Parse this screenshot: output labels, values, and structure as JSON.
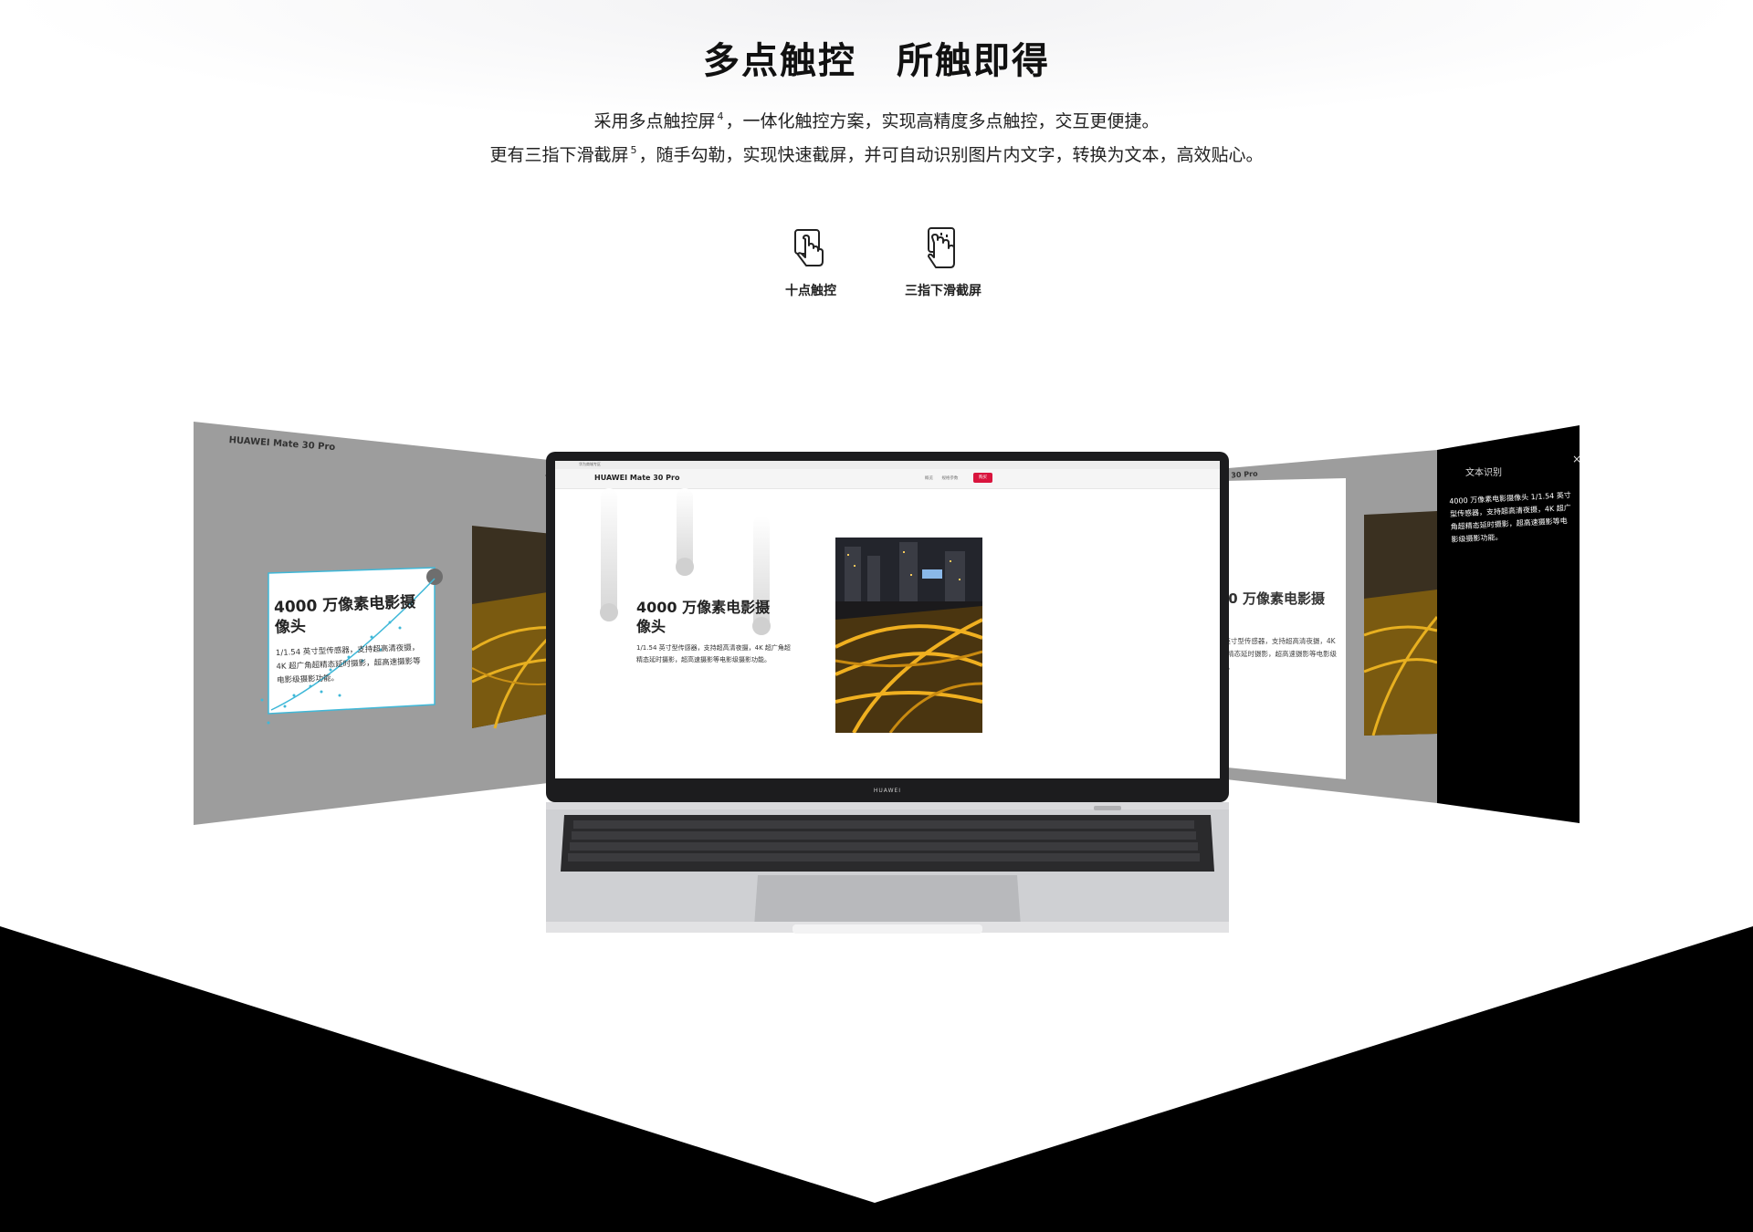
{
  "headline": {
    "part1": "多点触控",
    "part2": "所触即得"
  },
  "description": {
    "line1_a": "采用多点触控屏",
    "line1_sup": "4",
    "line1_b": "，一体化触控方案，实现高精度多点触控，交互更便捷。",
    "line2_a": "更有三指下滑截屏",
    "line2_sup": "5",
    "line2_b": "，随手勾勒，实现快速截屏，并可自动识别图片内文字，转换为文本，高效贴心。"
  },
  "features": [
    {
      "label": "十点触控",
      "icon": "single-finger-touch-icon"
    },
    {
      "label": "三指下滑截屏",
      "icon": "three-finger-swipe-icon"
    }
  ],
  "product_page": {
    "brand": "HUAWEI Mate 30 Pro",
    "top_bar_text": "华为商城专区",
    "nav_links": [
      "概览",
      "规格参数"
    ],
    "buy_label": "购买",
    "heading": "4000 万像素电影摄像头",
    "body": "1/1.54 英寸型传感器，支持超高清夜摄，4K 超广角超精态延时摄影，超高速摄影等电影级摄影功能。"
  },
  "ocr_panel": {
    "title": "文本识别",
    "close": "×",
    "result": "4000 万像素电影摄像头 1/1.54 英寸型传感器，支持超高清夜摄，4K 超广角超精态延时摄影，超高速摄影等电影级摄影功能。"
  },
  "laptop_logo": "HUAWEI",
  "colors": {
    "accent_red": "#d9143d",
    "selection_cyan": "#3fb8d8",
    "panel_gray": "#9d9d9d",
    "black": "#000000"
  }
}
